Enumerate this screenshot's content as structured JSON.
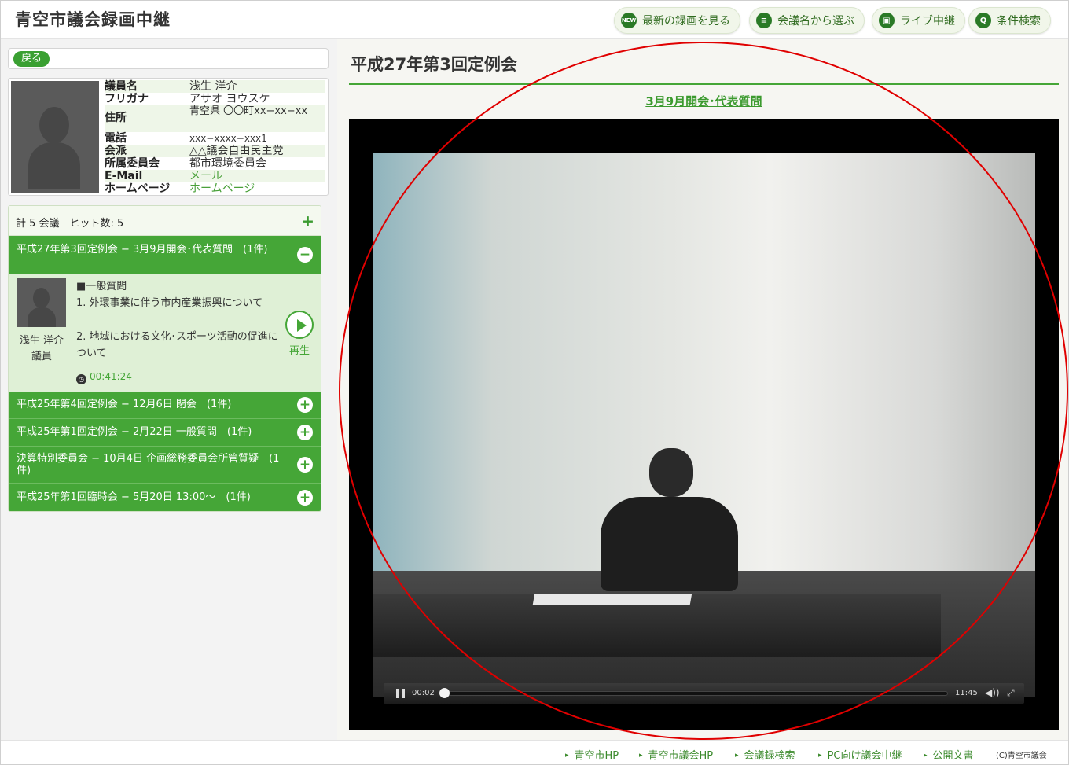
{
  "header": {
    "site_title": "青空市議会録画中継",
    "nav": [
      {
        "label": "最新の録画を見る",
        "icon": "new-icon",
        "icon_text": "NEW"
      },
      {
        "label": "会議名から選ぶ",
        "icon": "list-icon",
        "icon_text": "≡"
      },
      {
        "label": "ライブ中継",
        "icon": "camera-icon",
        "icon_text": "▣"
      },
      {
        "label": "条件検索",
        "icon": "search-icon",
        "icon_text": "Q"
      }
    ]
  },
  "sidebar": {
    "back_label": "戻る",
    "profile": {
      "rows": [
        {
          "key": "議員名",
          "value": "浅生 洋介"
        },
        {
          "key": "フリガナ",
          "value": "アサオ ヨウスケ"
        },
        {
          "key": "住所",
          "value": "青空県 〇〇町xx−xx−xx"
        },
        {
          "key": "電話",
          "value": "xxx−xxxx−xxx1"
        },
        {
          "key": "会派",
          "value": "△△議会自由民主党"
        },
        {
          "key": "所属委員会",
          "value": "都市環境委員会"
        },
        {
          "key": "E-Mail",
          "value": "メール"
        },
        {
          "key": "ホームページ",
          "value": "ホームページ"
        }
      ]
    },
    "summary": "計 5 会議　ヒット数: 5",
    "groups": [
      {
        "label": "平成27年第3回定例会 − 3月9月開会･代表質問　(1件)",
        "toggle": "−"
      },
      {
        "label": "平成25年第4回定例会 − 12月6日 閉会　(1件)",
        "toggle": "+"
      },
      {
        "label": "平成25年第1回定例会 − 2月22日 一般質問　(1件)",
        "toggle": "+"
      },
      {
        "label": "決算特別委員会 − 10月4日 企画総務委員会所管質疑　(1件)",
        "toggle": "+"
      },
      {
        "label": "平成25年第1回臨時会 − 5月20日 13:00〜　(1件)",
        "toggle": "+"
      }
    ],
    "detail": {
      "speaker": "浅生 洋介議員",
      "heading": "■一般質問",
      "items": [
        "1. 外環事業に伴う市内産業振興について",
        "2. 地域における文化･スポーツ活動の促進について"
      ],
      "play_label": "再生",
      "time": "00:41:24"
    }
  },
  "main": {
    "title": "平成27年第3回定例会",
    "subtitle": "3月9月開会･代表質問",
    "player": {
      "current_time": "00:02",
      "duration": "11:45",
      "volume_icon": "◀))",
      "progress": 0.003
    }
  },
  "footer": {
    "links": [
      "青空市HP",
      "青空市議会HP",
      "会議録検索",
      "PC向け議会中継",
      "公開文書"
    ],
    "copyright": "(C)青空市議会"
  },
  "colors": {
    "accent": "#45a637",
    "annotation": "#e00000"
  }
}
